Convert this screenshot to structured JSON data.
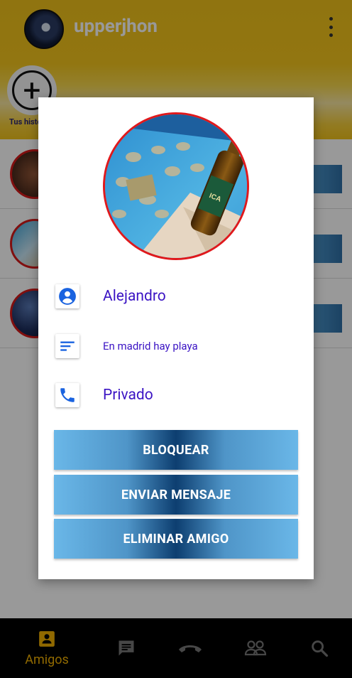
{
  "header": {
    "username": "upperjhon"
  },
  "stories": {
    "add_label": "Tus historias"
  },
  "dialog": {
    "name": "Alejandro",
    "status_text": "En madrid hay playa",
    "privacy": "Privado",
    "buttons": {
      "block": "BLOQUEAR",
      "send_message": "ENVIAR MENSAJE",
      "remove_friend": "ELIMINAR AMIGO"
    }
  },
  "bottom_nav": {
    "active": "Amigos",
    "items": [
      {
        "icon": "contact-card-icon",
        "label": "Amigos"
      },
      {
        "icon": "chat-icon",
        "label": ""
      },
      {
        "icon": "call-end-icon",
        "label": ""
      },
      {
        "icon": "people-icon",
        "label": ""
      },
      {
        "icon": "search-icon",
        "label": ""
      }
    ]
  },
  "colors": {
    "header_yellow": "#f1c21b",
    "accent_text": "#3b14c4",
    "button_blue_light": "#6ab7e8",
    "button_blue_dark": "#0d3e70",
    "avatar_ring": "#e0191c",
    "nav_active": "#f0b000"
  }
}
